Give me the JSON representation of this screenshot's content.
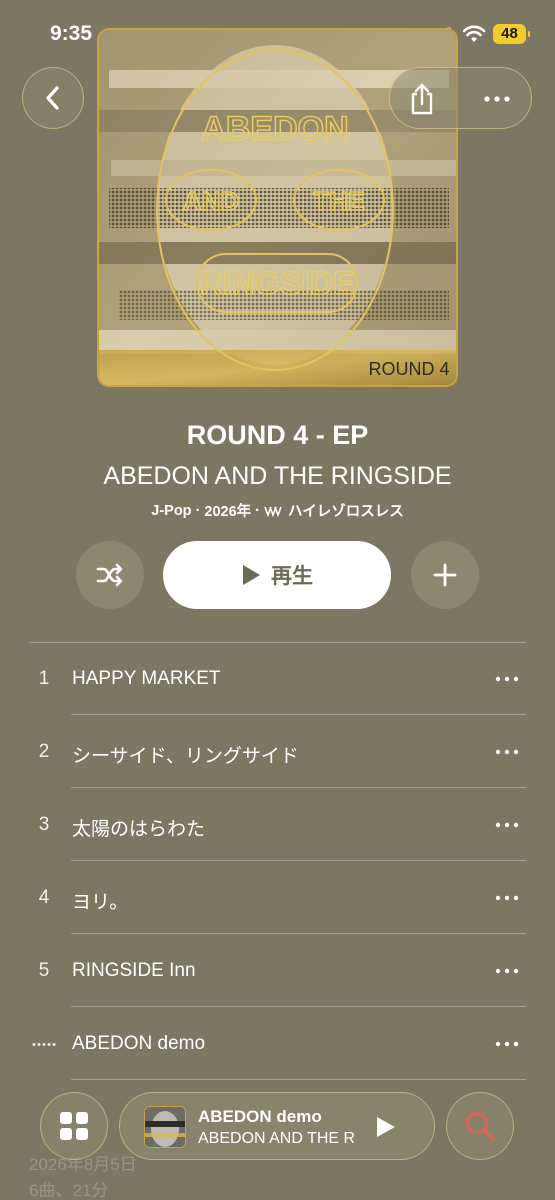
{
  "status_bar": {
    "time": "9:35",
    "battery": "48"
  },
  "album": {
    "title": "ROUND 4 - EP",
    "artist": "ABEDON AND THE RINGSIDE",
    "genre": "J-Pop",
    "year": "2026年",
    "quality": "ハイレゾロスレス",
    "cover_lines": [
      "ABEDON",
      "AND",
      "THE",
      "RINGSIDE",
      "ROUND 4"
    ]
  },
  "actions": {
    "play_label": "再生"
  },
  "tracks": [
    {
      "number": "1",
      "title": "HAPPY MARKET"
    },
    {
      "number": "2",
      "title": "シーサイド、リングサイド"
    },
    {
      "number": "3",
      "title": "太陽のはらわた"
    },
    {
      "number": "4",
      "title": "ヨリ。"
    },
    {
      "number": "5",
      "title": "RINGSIDE Inn"
    },
    {
      "number": "",
      "title": "ABEDON demo"
    }
  ],
  "footer": {
    "release_date": "2026年8月5日",
    "summary": "6曲、21分"
  },
  "mini_player": {
    "title": "ABEDON demo",
    "artist": "ABEDON AND THE RINGSIDE"
  },
  "colors": {
    "background": "#7b7763",
    "accent_gold": "#c9a43c",
    "battery": "#f2cd2a",
    "search_icon": "#e0605a"
  }
}
